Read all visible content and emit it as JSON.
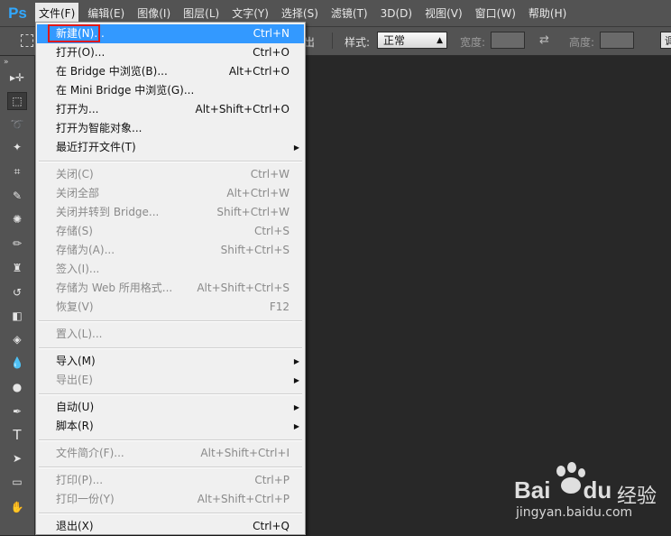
{
  "app": {
    "logo": "Ps"
  },
  "menubar": {
    "items": [
      "文件(F)",
      "编辑(E)",
      "图像(I)",
      "图层(L)",
      "文字(Y)",
      "选择(S)",
      "滤镜(T)",
      "3D(D)",
      "视图(V)",
      "窗口(W)",
      "帮助(H)"
    ],
    "active_index": 0
  },
  "options_bar": {
    "partial_label": "岀",
    "style_label": "样式:",
    "style_value": "正常",
    "width_label": "宽度:",
    "height_label": "高度:",
    "button_partial": "调"
  },
  "file_menu": {
    "items": [
      {
        "label": "新建(N)...",
        "shortcut": "Ctrl+N",
        "highlight": true
      },
      {
        "label": "打开(O)...",
        "shortcut": "Ctrl+O"
      },
      {
        "label": "在 Bridge 中浏览(B)...",
        "shortcut": "Alt+Ctrl+O"
      },
      {
        "label": "在 Mini Bridge 中浏览(G)...",
        "shortcut": ""
      },
      {
        "label": "打开为...",
        "shortcut": "Alt+Shift+Ctrl+O"
      },
      {
        "label": "打开为智能对象...",
        "shortcut": ""
      },
      {
        "label": "最近打开文件(T)",
        "shortcut": "",
        "submenu": true
      },
      {
        "separator": true
      },
      {
        "label": "关闭(C)",
        "shortcut": "Ctrl+W",
        "disabled": true
      },
      {
        "label": "关闭全部",
        "shortcut": "Alt+Ctrl+W",
        "disabled": true
      },
      {
        "label": "关闭并转到 Bridge...",
        "shortcut": "Shift+Ctrl+W",
        "disabled": true
      },
      {
        "label": "存储(S)",
        "shortcut": "Ctrl+S",
        "disabled": true
      },
      {
        "label": "存储为(A)...",
        "shortcut": "Shift+Ctrl+S",
        "disabled": true
      },
      {
        "label": "签入(I)...",
        "shortcut": "",
        "disabled": true
      },
      {
        "label": "存储为 Web 所用格式...",
        "shortcut": "Alt+Shift+Ctrl+S",
        "disabled": true
      },
      {
        "label": "恢复(V)",
        "shortcut": "F12",
        "disabled": true
      },
      {
        "separator": true
      },
      {
        "label": "置入(L)...",
        "shortcut": "",
        "disabled": true
      },
      {
        "separator": true
      },
      {
        "label": "导入(M)",
        "shortcut": "",
        "submenu": true
      },
      {
        "label": "导出(E)",
        "shortcut": "",
        "submenu": true,
        "disabled": true
      },
      {
        "separator": true
      },
      {
        "label": "自动(U)",
        "shortcut": "",
        "submenu": true
      },
      {
        "label": "脚本(R)",
        "shortcut": "",
        "submenu": true
      },
      {
        "separator": true
      },
      {
        "label": "文件简介(F)...",
        "shortcut": "Alt+Shift+Ctrl+I",
        "disabled": true
      },
      {
        "separator": true
      },
      {
        "label": "打印(P)...",
        "shortcut": "Ctrl+P",
        "disabled": true
      },
      {
        "label": "打印一份(Y)",
        "shortcut": "Alt+Shift+Ctrl+P",
        "disabled": true
      },
      {
        "separator": true
      },
      {
        "label": "退出(X)",
        "shortcut": "Ctrl+Q"
      }
    ]
  },
  "tools": [
    "move-icon",
    "rect-marquee-icon",
    "lasso-icon",
    "magic-wand-icon",
    "crop-icon",
    "eyedropper-icon",
    "healing-brush-icon",
    "brush-icon",
    "clone-stamp-icon",
    "history-brush-icon",
    "eraser-icon",
    "paint-bucket-icon",
    "blur-icon",
    "dodge-icon",
    "pen-icon",
    "type-icon",
    "path-select-icon",
    "rectangle-icon",
    "hand-icon"
  ],
  "watermark": {
    "brand": "Bai",
    "brand2": "du",
    "cn": "经验",
    "url": "jingyan.baidu.com"
  },
  "colors": {
    "highlight": "#3399ff",
    "red_box": "#e01818",
    "ps_blue": "#31a8ff"
  }
}
